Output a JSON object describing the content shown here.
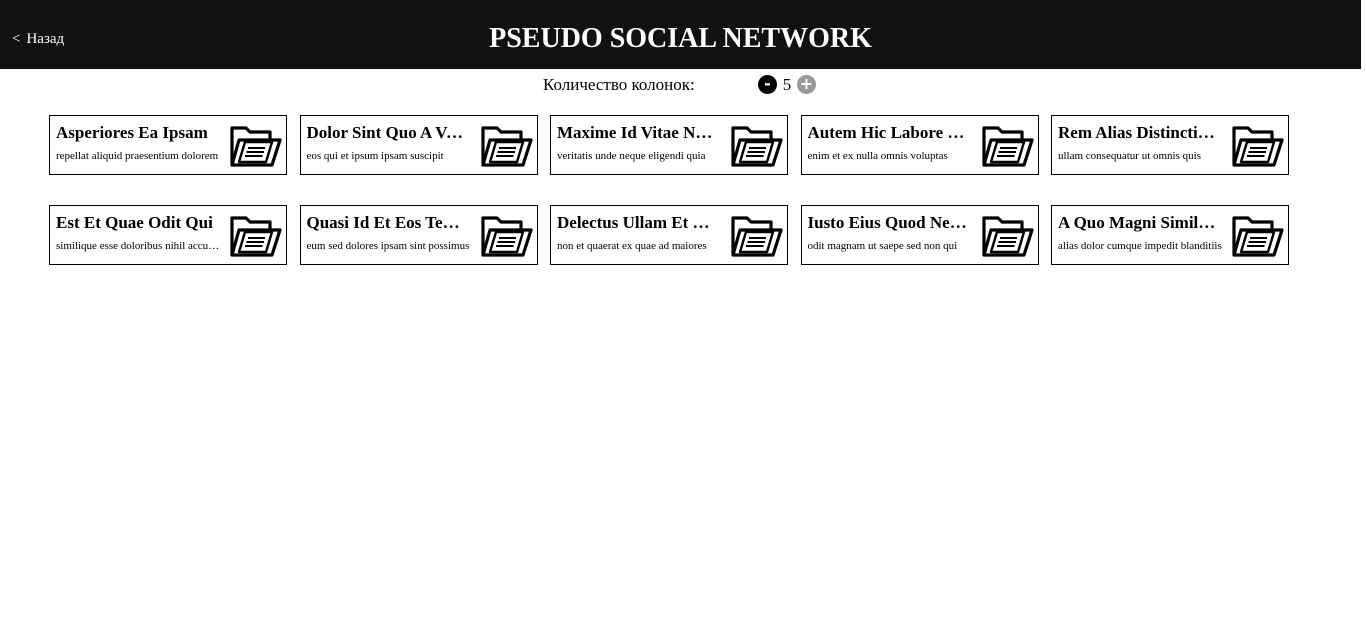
{
  "header": {
    "back_arrow": "<",
    "back_label": "Назад",
    "title": "PSEUDO SOCIAL NETWORK"
  },
  "columns": {
    "label": "Количество колонок:",
    "value": "5",
    "minus": "-",
    "plus": "+"
  },
  "colors": {
    "header_bg": "#111111",
    "minus_bg": "#000000",
    "plus_bg": "#9a9a9a"
  },
  "cards": [
    {
      "title": "Asperiores Ea Ipsam",
      "text": "repellat aliquid praesentium dolorem",
      "icon": "open-folder-document-icon"
    },
    {
      "title": "Dolor Sint Quo A Velit",
      "text": "eos qui et ipsum ipsam suscipit",
      "icon": "open-folder-document-icon"
    },
    {
      "title": "Maxime Id Vitae Nihil",
      "text": "veritatis unde neque eligendi quia",
      "icon": "open-folder-document-icon"
    },
    {
      "title": "Autem Hic Labore Sunt",
      "text": "enim et ex nulla omnis voluptas",
      "icon": "open-folder-document-icon"
    },
    {
      "title": "Rem Alias Distinctio Eius",
      "text": "ullam consequatur ut omnis quis",
      "icon": "open-folder-document-icon"
    },
    {
      "title": "Est Et Quae Odit Qui",
      "text": "similique esse doloribus nihil accusamus",
      "icon": "open-folder-document-icon"
    },
    {
      "title": "Quasi Id Et Eos Tenetur",
      "text": "eum sed dolores ipsam sint possimus",
      "icon": "open-folder-document-icon"
    },
    {
      "title": "Delectus Ullam Et Corporis",
      "text": "non et quaerat ex quae ad maiores",
      "icon": "open-folder-document-icon"
    },
    {
      "title": "Iusto Eius Quod Necessitatibus",
      "text": "odit magnam ut saepe sed non qui",
      "icon": "open-folder-document-icon"
    },
    {
      "title": "A Quo Magni Similique",
      "text": "alias dolor cumque impedit blanditiis",
      "icon": "open-folder-document-icon"
    }
  ]
}
